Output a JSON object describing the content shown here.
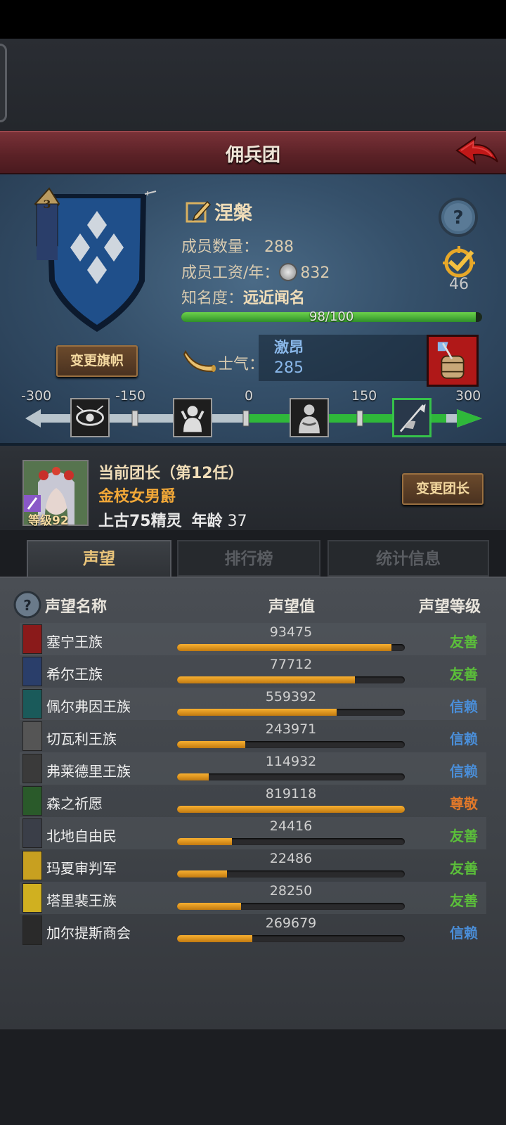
{
  "header": {
    "title": "佣兵团"
  },
  "guild": {
    "banner_rank": "3",
    "name": "涅槃",
    "member_count_label": "成员数量：",
    "member_count": "288",
    "salary_label": "成员工资/年：",
    "salary": "832",
    "fame_label": "知名度：",
    "fame_value": "远近闻名",
    "fame_progress_text": "98/100",
    "fame_progress": 0.98,
    "morale_label": "士气：",
    "morale_state": "激昂",
    "morale_value": "285",
    "target_count": "46",
    "change_banner_label": "变更旗帜"
  },
  "morale_scale": {
    "ticks": [
      "-300",
      "-150",
      "0",
      "150",
      "300"
    ],
    "icons": [
      "eye-curse-icon",
      "despair-icon",
      "calm-icon",
      "rally-flag-icon"
    ],
    "current": 285
  },
  "leader": {
    "title": "当前团长（第12任）",
    "name": "金枝女男爵",
    "level_label": "等级92",
    "race": "上古75精灵",
    "age_label": "年龄",
    "age": "37",
    "change_leader_label": "变更团长"
  },
  "tabs": [
    {
      "label": "声望",
      "active": true
    },
    {
      "label": "排行榜",
      "active": false
    },
    {
      "label": "统计信息",
      "active": false
    }
  ],
  "reputation": {
    "columns": [
      "声望名称",
      "声望值",
      "声望等级"
    ],
    "rows": [
      {
        "name": "塞宁王族",
        "value": "93475",
        "fill": 0.94,
        "level": "友善",
        "level_color": "#5bbf3a",
        "icon_color": "#8a1a1a"
      },
      {
        "name": "希尔王族",
        "value": "77712",
        "fill": 0.78,
        "level": "友善",
        "level_color": "#5bbf3a",
        "icon_color": "#2a3e6a"
      },
      {
        "name": "佩尔弗因王族",
        "value": "559392",
        "fill": 0.7,
        "level": "信赖",
        "level_color": "#4a8ed8",
        "icon_color": "#1a5a5a"
      },
      {
        "name": "切瓦利王族",
        "value": "243971",
        "fill": 0.3,
        "level": "信赖",
        "level_color": "#4a8ed8",
        "icon_color": "#555555"
      },
      {
        "name": "弗莱德里王族",
        "value": "114932",
        "fill": 0.14,
        "level": "信赖",
        "level_color": "#4a8ed8",
        "icon_color": "#3a3a3a"
      },
      {
        "name": "森之祈愿",
        "value": "819118",
        "fill": 1.0,
        "level": "尊敬",
        "level_color": "#e0782a",
        "icon_color": "#2a5a2a"
      },
      {
        "name": "北地自由民",
        "value": "24416",
        "fill": 0.24,
        "level": "友善",
        "level_color": "#5bbf3a",
        "icon_color": "#3a3e48"
      },
      {
        "name": "玛夏审判军",
        "value": "22486",
        "fill": 0.22,
        "level": "友善",
        "level_color": "#5bbf3a",
        "icon_color": "#c8a020"
      },
      {
        "name": "塔里裴王族",
        "value": "28250",
        "fill": 0.28,
        "level": "友善",
        "level_color": "#5bbf3a",
        "icon_color": "#d0b020"
      },
      {
        "name": "加尔提斯商会",
        "value": "269679",
        "fill": 0.33,
        "level": "信赖",
        "level_color": "#4a8ed8",
        "icon_color": "#2a2a2a"
      }
    ]
  }
}
